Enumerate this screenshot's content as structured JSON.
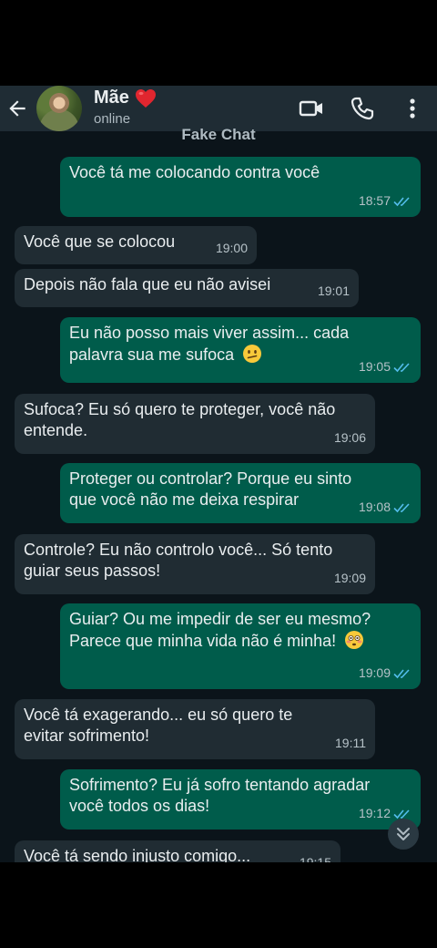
{
  "header": {
    "contact_name": "Mãe",
    "status": "online",
    "subtitle": "Fake Chat"
  },
  "icons": {
    "back": "arrow-left-icon",
    "video": "video-camera-icon",
    "call": "phone-icon",
    "menu": "more-vertical-icon",
    "heart": "red-heart-emoji",
    "read_receipt": "double-check-icon",
    "scroll": "chevron-double-down-icon"
  },
  "colors": {
    "background": "#0b141a",
    "header": "#1f2c34",
    "incoming_bubble": "#202c33",
    "outgoing_bubble": "#005c4b",
    "read_tick": "#53bdeb"
  },
  "messages": [
    {
      "dir": "out",
      "text": "Você tá me colocando contra você",
      "time": "18:57",
      "read": true
    },
    {
      "dir": "in",
      "text": "Você que se colocou",
      "time": "19:00"
    },
    {
      "dir": "in",
      "text": "Depois não fala que eu não avisei",
      "time": "19:01"
    },
    {
      "dir": "out",
      "line1": "Eu não posso mais viver assim... cada",
      "line2": "palavra sua me sufoca",
      "emoji": "confused-face",
      "time": "19:05",
      "read": true
    },
    {
      "dir": "in",
      "line1": "Sufoca? Eu só quero te proteger, você não",
      "line2": "entende.",
      "time": "19:06"
    },
    {
      "dir": "out",
      "line1": "Proteger ou controlar? Porque eu sinto",
      "line2": "que você não me deixa respirar",
      "time": "19:08",
      "read": true
    },
    {
      "dir": "in",
      "line1": "Controle? Eu não controlo você... Só tento",
      "line2": "guiar seus passos!",
      "time": "19:09"
    },
    {
      "dir": "out",
      "line1": "Guiar? Ou me impedir de ser eu mesmo?",
      "line2": "Parece que minha vida não é minha!",
      "emoji": "flushed-face",
      "time": "19:09",
      "read": true
    },
    {
      "dir": "in",
      "line1": "Você tá exagerando... eu só quero te",
      "line2": "evitar sofrimento!",
      "time": "19:11"
    },
    {
      "dir": "out",
      "line1": "Sofrimento? Eu já sofro tentando agradar",
      "line2": "você todos os dias!",
      "time": "19:12",
      "read": true
    },
    {
      "dir": "in",
      "text": "Você tá sendo injusto comigo...",
      "time": "19:15"
    }
  ]
}
